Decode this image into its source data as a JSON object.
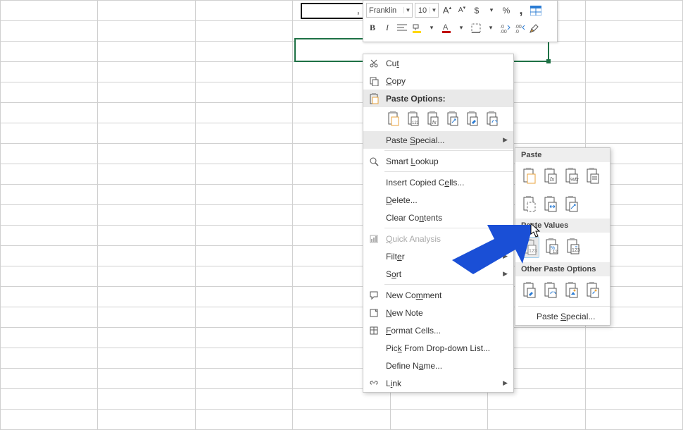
{
  "cell": {
    "value": ","
  },
  "toolbar": {
    "font": "Franklin",
    "size": "10",
    "inc_font": "A",
    "dec_font": "A",
    "currency": "$",
    "percent": "%",
    "comma_style": ",",
    "bold": "B",
    "italic": "I"
  },
  "menu": {
    "cut": "Cut",
    "copy": "Copy",
    "paste_options": "Paste Options:",
    "paste_special": "Paste Special...",
    "smart_lookup": "Smart Lookup",
    "insert_copied": "Insert Copied Cells...",
    "delete": "Delete...",
    "clear_contents": "Clear Contents",
    "quick_analysis": "Quick Analysis",
    "filter": "Filter",
    "sort": "Sort",
    "new_comment": "New Comment",
    "new_note": "New Note",
    "format_cells": "Format Cells...",
    "pick_list": "Pick From Drop-down List...",
    "define_name": "Define Name...",
    "link": "Link"
  },
  "submenu": {
    "paste": "Paste",
    "paste_values": "Paste Values",
    "other": "Other Paste Options",
    "paste_special": "Paste Special..."
  }
}
